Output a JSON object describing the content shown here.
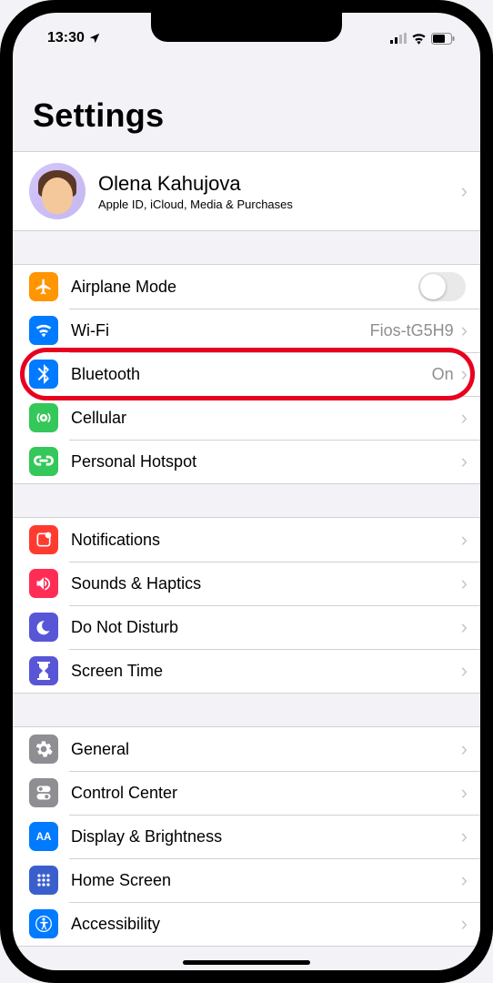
{
  "status_bar": {
    "time": "13:30",
    "location_icon": "location-arrow",
    "signal_icon": "cellular",
    "wifi_icon": "wifi",
    "battery_icon": "battery"
  },
  "page_title": "Settings",
  "profile": {
    "name": "Olena Kahujova",
    "subtitle": "Apple ID, iCloud, Media & Purchases"
  },
  "sections": {
    "connectivity": {
      "airplane": {
        "label": "Airplane Mode",
        "toggle": false,
        "icon_color": "#ff9500"
      },
      "wifi": {
        "label": "Wi-Fi",
        "value": "Fios-tG5H9",
        "icon_color": "#007aff"
      },
      "bluetooth": {
        "label": "Bluetooth",
        "value": "On",
        "icon_color": "#007aff",
        "highlighted": true
      },
      "cellular": {
        "label": "Cellular",
        "icon_color": "#34c759"
      },
      "hotspot": {
        "label": "Personal Hotspot",
        "icon_color": "#34c759"
      }
    },
    "notifications_group": {
      "notifications": {
        "label": "Notifications",
        "icon_color": "#ff3b30"
      },
      "sounds": {
        "label": "Sounds & Haptics",
        "icon_color": "#ff2d55"
      },
      "dnd": {
        "label": "Do Not Disturb",
        "icon_color": "#5856d6"
      },
      "screentime": {
        "label": "Screen Time",
        "icon_color": "#5856d6"
      }
    },
    "general_group": {
      "general": {
        "label": "General",
        "icon_color": "#8e8e93"
      },
      "control_center": {
        "label": "Control Center",
        "icon_color": "#8e8e93"
      },
      "display": {
        "label": "Display & Brightness",
        "icon_color": "#007aff"
      },
      "homescreen": {
        "label": "Home Screen",
        "icon_color": "#3355dd"
      },
      "accessibility": {
        "label": "Accessibility",
        "icon_color": "#007aff"
      }
    }
  }
}
